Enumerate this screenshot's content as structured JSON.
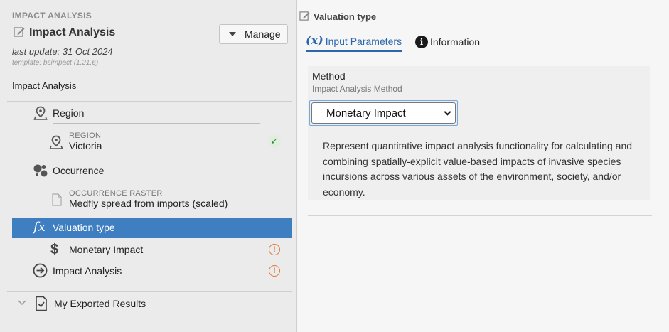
{
  "left_panel": {
    "section_header": "IMPACT ANALYSIS",
    "title": "Impact Analysis",
    "manage_label": "Manage",
    "last_update": "last update: 31 Oct 2024",
    "template": "template: bsimpact (1.21.6)",
    "root_label": "Impact Analysis",
    "tree": {
      "region": {
        "label": "Region",
        "sub_label": "REGION",
        "sub_value": "Victoria",
        "status": "ok"
      },
      "occurrence": {
        "label": "Occurrence",
        "sub_label": "OCCURRENCE RASTER",
        "sub_value": "Medfly spread from imports (scaled)"
      },
      "valuation": {
        "label": "Valuation type",
        "sub_value": "Monetary Impact",
        "status": "warning"
      },
      "impact": {
        "label": "Impact Analysis",
        "status": "warning"
      },
      "exported": {
        "label": "My Exported Results"
      }
    }
  },
  "right_panel": {
    "title": "Valuation type",
    "tabs": [
      {
        "label": "Input Parameters",
        "icon_text": "(x)",
        "active": true
      },
      {
        "label": "Information",
        "icon_text": "i",
        "active": false
      }
    ],
    "method": {
      "label": "Method",
      "sublabel": "Impact Analysis Method",
      "selected": "Monetary Impact",
      "description": "Represent quantitative impact analysis functionality for calculating and combining spatially-explicit value-based impacts of invasive species incursions across various assets of the environment, society, and/or economy."
    }
  },
  "colors": {
    "selection": "#3f7fc1",
    "accent": "#2a67ad",
    "warning": "#e0773a",
    "success": "#2f8a3b"
  },
  "icons": [
    "edit-icon",
    "dropdown-triangle-icon",
    "location-pin-icon",
    "occurrence-bubbles-icon",
    "file-icon",
    "fx-icon",
    "dollar-icon",
    "arrow-circle-right-icon",
    "chevron-down-icon",
    "document-check-icon",
    "warning-icon",
    "check-icon",
    "info-icon"
  ]
}
